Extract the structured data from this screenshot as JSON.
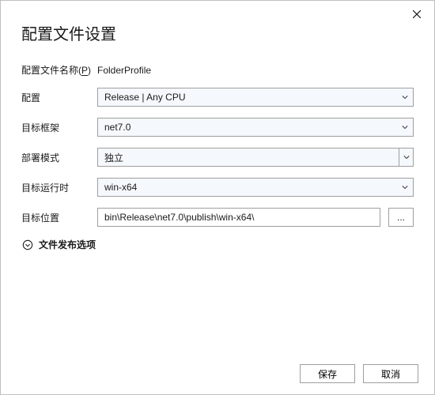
{
  "title": "配置文件设置",
  "profile_name": {
    "label_prefix": "配置文件名称(",
    "label_hotkey": "P",
    "label_suffix": ")",
    "value": "FolderProfile"
  },
  "fields": {
    "configuration": {
      "label": "配置",
      "value": "Release | Any CPU"
    },
    "target_framework": {
      "label": "目标框架",
      "value": "net7.0"
    },
    "deployment_mode": {
      "label": "部署模式",
      "value": "独立"
    },
    "target_runtime": {
      "label": "目标运行时",
      "value": "win-x64"
    },
    "target_location": {
      "label": "目标位置",
      "value": "bin\\Release\\net7.0\\publish\\win-x64\\"
    }
  },
  "browse_button": "...",
  "expander_label": "文件发布选项",
  "buttons": {
    "save": "保存",
    "cancel": "取消"
  }
}
